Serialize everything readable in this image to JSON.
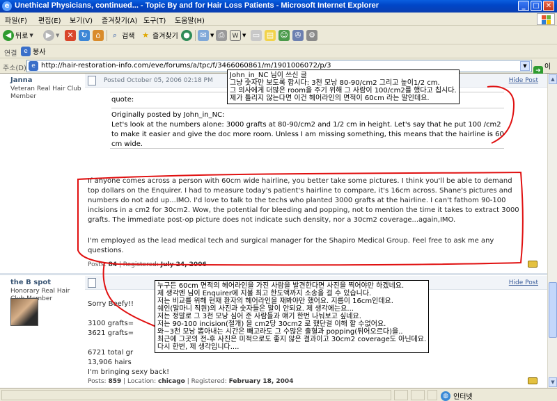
{
  "window": {
    "title": "Unethical Physicians, continued... - Topic By and for Hair Loss Patients - Microsoft Internet Explorer",
    "controls": {
      "minimize": "_",
      "maximize": "□",
      "close": "✕"
    }
  },
  "menu": [
    "파일(F)",
    "편집(E)",
    "보기(V)",
    "즐겨찾기(A)",
    "도구(T)",
    "도움말(H)"
  ],
  "toolbar": {
    "back": "뒤로",
    "search": "검색",
    "favorites": "즐겨찾기"
  },
  "links": {
    "label": "연결",
    "item": "봉사"
  },
  "address": {
    "label": "주소(D)",
    "url": "http://hair-restoration-info.com/eve/forums/a/tpc/f/3466060861/m/1901006072/p/3",
    "go": "이동"
  },
  "posts": [
    {
      "author": "Janna",
      "rank": "Veteran Real Hair Club Member",
      "date": "Posted October 05, 2006 02:18 PM",
      "hide": "Hide Post",
      "quote_header": "quote:",
      "quote_attrib": "Originally posted by John_in_NC:",
      "quote_body": "Let's look at the numbers alone: 3000 grafts at 80-90/cm2 and 1/2 cm in height. Let's say that he put 100 /cm2 to make it easier and give the doc more room. Unless I am missing something, this means that the hairline is 60 cm wide.",
      "body": "If anyone comes across a person with 60cm wide hairline, you better take some pictures. I think you'll be able to demand top dollars on the Enquirer. I had to measure today's patient's hairline to compare, it's 16cm across. Shane's pictures and numbers do not add up...IMO. I'd love to talk to the techs who planted 3000 grafts at the hairline. I can't fathom 90-100 incisions in a cm2 for 30cm2. Wow, the potential for bleeding and popping, not to mention the time it takes to extract 3000 grafts. The immediate post-op picture does not indicate such density, nor a 30cm2 coverage...again,IMO.",
      "body2": "I'm employed as the lead medical tech and surgical manager for the Shapiro Medical Group. Feel free to ask me any questions.",
      "footer_posts_label": "Posts:",
      "footer_posts": "84",
      "footer_reg_label": "Registered:",
      "footer_reg": "July 24, 2006"
    },
    {
      "author": "the B spot",
      "rank": "Honorary Real Hair Club Member",
      "hide": "Hide Post",
      "lines": [
        "Sorry Beefy!!",
        "3100 grafts=",
        "3621 grafts=",
        "",
        "6721 total gr",
        "13,906 hairs",
        "I'm bringing sexy back!"
      ],
      "footer_posts_label": "Posts:",
      "footer_posts": "859",
      "footer_loc_label": "Location:",
      "footer_loc": "chicago",
      "footer_reg_label": "Registered:",
      "footer_reg": "February 18, 2004"
    }
  ],
  "tooltips": {
    "top": "John_in_NC 님이 쓰신 글\n그냥 숫자만 보도록 합시다: 3천 모낭 80-90/cm2 그리고 높이1/2 cm.\n그 의사에게 더많은 room을 주기 위해 그 사람이 100/cm2를 했다고 칩시다.\n제가 틀리지 않는다면 이건 헤어라인의 면적이 60cm 라는 말인데요.",
    "bottom": "누구든 60cm 면적의 헤어라인을 가진 사람을 발견한다면 사진을 찍어야만 하겠네요.\n제 생각엔 님이 Enquirer에 지불 최고 한도액까지 소송을 걸 수 있습니다.\n저는 비교를 위해 현재 환자의 헤어라인을 재봐야만 했어요. 지름이 16cm인데요.\n쉐인(말마니 직원)의 사진과 숫자들은 말이 안되요. 제 생각에는요...\n저는 정말로 그 3천 모낭 심어 준 사람들과 얘기 한번 나눠보고 싶네요.\n저는 90-100 incision(절개) 을 cm2당 30cm2 로 했단걸 이해 할 수없어요.\n와~3천 모낭 뽑아내는 시간은 빼고라도 그 수많은 출혈과 popping(튀어오르다)을..\n최근에 그곳의 전-후 사진은 미적으로도 좋지 않은 결과이고 30cm2 coverage도 아닌데요.\n다시 한번, 제 생각입니다...."
  },
  "status": {
    "zone": "인터넷"
  },
  "colors": {
    "titlebar": "#0a5fe0",
    "annotation": "#e01010",
    "username": "#3a5675"
  }
}
